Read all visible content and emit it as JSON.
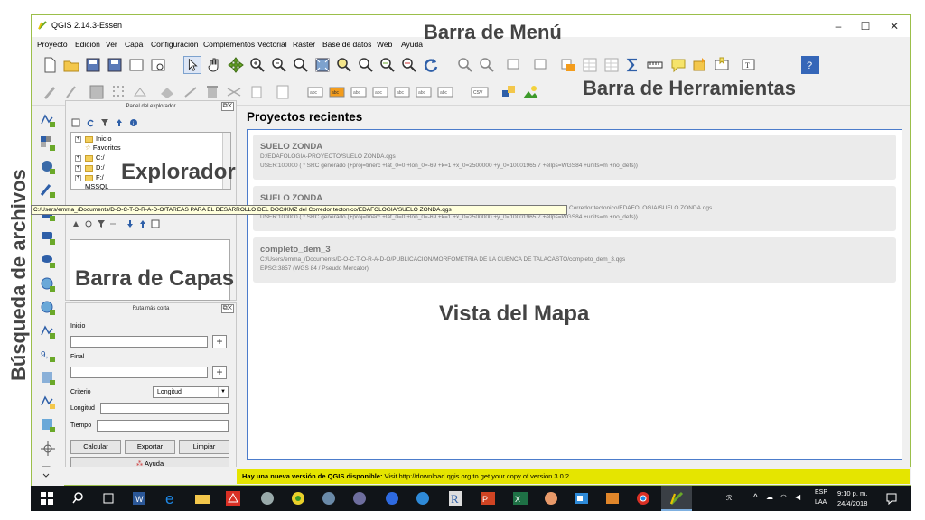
{
  "window": {
    "title": "QGIS 2.14.3-Essen",
    "minimize": "–",
    "maximize": "☐",
    "close": "✕"
  },
  "menu": [
    "Proyecto",
    "Edición",
    "Ver",
    "Capa",
    "Configuración",
    "Complementos",
    "Vectorial",
    "Ráster",
    "Base de datos",
    "Web",
    "Ayuda"
  ],
  "browser_panel": {
    "title": "Panel del explorador",
    "tree": [
      "Inicio",
      "Favoritos",
      "C:/",
      "D:/",
      "F:/",
      "MSSQL"
    ]
  },
  "tooltip": "C:/Users/emma_/Documents/D-O-C-T-O-R-A-D-O/TAREAS PARA EL DESARROLLO DEL DOC/KMZ del Corredor tectonico/EDAFOLOGIA/SUELO ZONDA.qgs",
  "route_panel": {
    "title": "Ruta más corta",
    "start_label": "Inicio",
    "end_label": "Final",
    "criterion_label": "Criterio",
    "criterion_value": "Longitud",
    "length_label": "Longitud",
    "time_label": "Tiempo",
    "calculate": "Calcular",
    "export": "Exportar",
    "clear": "Limpiar",
    "help": "Ayuda"
  },
  "recent": {
    "title": "Proyectos recientes",
    "projects": [
      {
        "name": "SUELO ZONDA",
        "path": "D:/EDAFOLOGIA-PROYECTO/SUELO ZONDA.qgs",
        "crs": "USER:100000 ( * SRC generado (+proj=tmerc +lat_0=0 +lon_0=-69 +k=1 +x_0=2500000 +y_0=10001965.7 +ellps=WGS84 +units=m +no_defs))"
      },
      {
        "name": "SUELO ZONDA",
        "path": "",
        "crs": "USER:100000 ( * SRC generado (+proj=tmerc +lat_0=0 +lon_0=-69 +k=1 +x_0=2500000 +y_0=10001965.7 +ellps=WGS84 +units=m +no_defs))",
        "path_tail": "Corredor tectonico/EDAFOLOGIA/SUELO ZONDA.qgs"
      },
      {
        "name": "completo_dem_3",
        "path": "C:/Users/emma_/Documents/D-O-C-T-O-R-A-D-O/PUBLICACION/MORFOMETRIA DE LA CUENCA DE TALACASTO/completo_dem_3.qgs",
        "crs": "EPSG:3857 (WGS 84 / Pseudo Mercator)"
      }
    ]
  },
  "update_bar": {
    "bold": "Hay una nueva versión de QGIS disponible:",
    "text": " Visit http://download.qgis.org to get your copy of version 3.0.2"
  },
  "annotations": {
    "menu_bar": "Barra de Menú",
    "toolbars": "Barra de Herramientas",
    "explorer": "Explorador",
    "layers_bar": "Barra de Capas",
    "map_view": "Vista del Mapa",
    "file_search": "Búsqueda de archivos"
  },
  "taskbar": {
    "lang": "ESP",
    "lang2": "LAA",
    "time": "9:10 p. m.",
    "date": "24/4/2018"
  }
}
